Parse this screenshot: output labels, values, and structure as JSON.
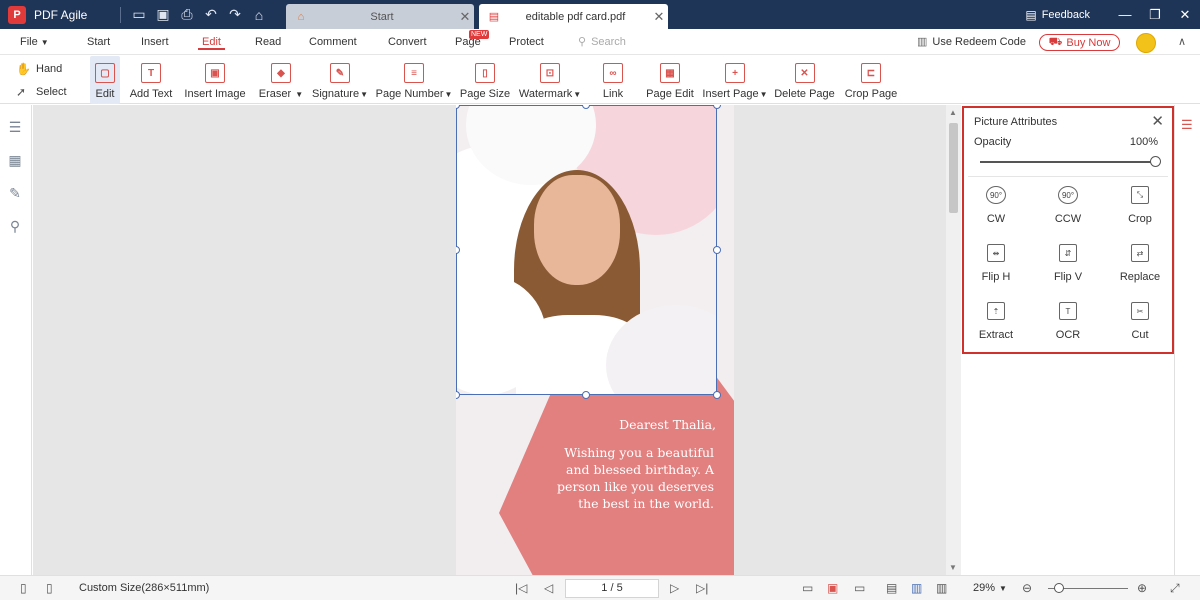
{
  "app": {
    "title": "PDF Agile",
    "logo_letter": "P"
  },
  "tabs": [
    {
      "label": "Start"
    },
    {
      "label": "editable pdf card.pdf"
    }
  ],
  "titlebar": {
    "feedback_label": "Feedback"
  },
  "menu": {
    "items": [
      "File",
      "Start",
      "Insert",
      "Edit",
      "Read",
      "Comment",
      "Convert",
      "Page",
      "Protect"
    ],
    "active": "Edit",
    "new_badge": "NEW",
    "search_placeholder": "Search",
    "redeem_label": "Use Redeem Code",
    "buy_label": "Buy Now"
  },
  "toolbar": {
    "hand_label": "Hand",
    "select_label": "Select",
    "tools": [
      {
        "label": "Edit",
        "icon": "edit-icon"
      },
      {
        "label": "Add Text",
        "icon": "text-icon"
      },
      {
        "label": "Insert Image",
        "icon": "image-icon"
      },
      {
        "label": "Eraser",
        "icon": "eraser-icon"
      },
      {
        "label": "Signature",
        "icon": "signature-icon"
      },
      {
        "label": "Page Number",
        "icon": "page-number-icon"
      },
      {
        "label": "Page Size",
        "icon": "page-size-icon"
      },
      {
        "label": "Watermark",
        "icon": "watermark-icon"
      },
      {
        "label": "Link",
        "icon": "link-icon"
      },
      {
        "label": "Page Edit",
        "icon": "page-edit-icon"
      },
      {
        "label": "Insert Page",
        "icon": "insert-page-icon"
      },
      {
        "label": "Delete Page",
        "icon": "delete-page-icon"
      },
      {
        "label": "Crop Page",
        "icon": "crop-page-icon"
      }
    ]
  },
  "card": {
    "title": "Dearest Thalia,",
    "message": "Wishing you a beautiful and blessed birthday. A person like you deserves the best in the world."
  },
  "picture_attributes": {
    "title": "Picture Attributes",
    "opacity_label": "Opacity",
    "opacity_value": "100%",
    "opacity_level": 1.0,
    "buttons": [
      {
        "label": "CW",
        "icon": "rotate-cw-icon",
        "glyph": "90°"
      },
      {
        "label": "CCW",
        "icon": "rotate-ccw-icon",
        "glyph": "90°"
      },
      {
        "label": "Crop",
        "icon": "crop-icon",
        "glyph": "⤡"
      },
      {
        "label": "Flip H",
        "icon": "flip-horizontal-icon",
        "glyph": "⇹"
      },
      {
        "label": "Flip V",
        "icon": "flip-vertical-icon",
        "glyph": "⇵"
      },
      {
        "label": "Replace",
        "icon": "replace-icon",
        "glyph": "⇄"
      },
      {
        "label": "Extract",
        "icon": "extract-icon",
        "glyph": "⇡"
      },
      {
        "label": "OCR",
        "icon": "ocr-icon",
        "glyph": "T"
      },
      {
        "label": "Cut",
        "icon": "cut-icon",
        "glyph": "✂"
      }
    ]
  },
  "statusbar": {
    "page_size": "Custom Size(286×511mm)",
    "page_indicator": "1 / 5",
    "zoom": "29%",
    "zoom_level": 0.15
  },
  "colors": {
    "titlebar_bg": "#1f3558",
    "accent": "#d83b3b",
    "card_pink": "#e27f7f"
  }
}
